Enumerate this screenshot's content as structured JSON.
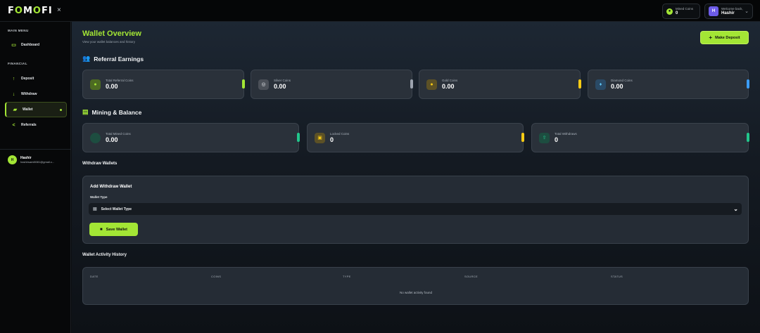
{
  "app": {
    "logo_prefix": "F",
    "logo_o": "O",
    "logo_m": "M",
    "logo_o2": "O",
    "logo_suffix": "FI",
    "close": "×"
  },
  "topbar": {
    "mined_label": "Mined Coins",
    "mined_value": "0",
    "welcome_label": "Welcome back,",
    "user_name": "Hashir",
    "user_initial": "H"
  },
  "sidebar": {
    "main_menu_title": "MAIN MENU",
    "financial_title": "FINANCIAL",
    "items": [
      {
        "label": "Dashboard",
        "icon": "monitor-icon"
      },
      {
        "label": "Deposit",
        "icon": "arrow-up-icon"
      },
      {
        "label": "Withdraw",
        "icon": "arrow-down-icon"
      },
      {
        "label": "Wallet",
        "icon": "wallet-icon"
      },
      {
        "label": "Referrals",
        "icon": "share-icon"
      }
    ],
    "profile_initial": "H",
    "profile_name": "Hashir",
    "profile_email": "hashirsami8081@gmail.c..."
  },
  "page": {
    "title": "Wallet Overview",
    "subtitle": "View your wallet balances and history",
    "deposit_button": "Make Deposit"
  },
  "referral": {
    "heading": "Referral Earnings",
    "cards": [
      {
        "label": "Total Referral Coins",
        "value": "0.00",
        "icon": "users-icon",
        "color": "#a3e635"
      },
      {
        "label": "Silver Coins",
        "value": "0.00",
        "icon": "silver-coin-icon",
        "color": "#9ca3af"
      },
      {
        "label": "Gold Coins",
        "value": "0.00",
        "icon": "gold-coin-icon",
        "color": "#facc15"
      },
      {
        "label": "Diamond Coins",
        "value": "0.00",
        "icon": "diamond-icon",
        "color": "#3b9cf6"
      }
    ]
  },
  "mining": {
    "heading": "Mining & Balance",
    "cards": [
      {
        "label": "Total Mined Coins",
        "value": "0.00",
        "icon": "mined-coin-icon",
        "color": "#22c58b"
      },
      {
        "label": "Locked Coins",
        "value": "0",
        "icon": "lock-icon",
        "color": "#facc15"
      },
      {
        "label": "Total Withdraws",
        "value": "0",
        "icon": "withdraw-icon",
        "color": "#22c58b"
      }
    ]
  },
  "withdraw_wallets": {
    "heading": "Withdraw Wallets",
    "panel_title": "Add Withdraw Wallet",
    "field_label": "Wallet Type",
    "select_value": "Select Wallet Type",
    "save_button": "Save Wallet"
  },
  "activity": {
    "heading": "Wallet Activity History",
    "columns": [
      "DATE",
      "COINS",
      "TYPE",
      "SOURCE",
      "STATUS"
    ],
    "empty_message": "No wallet activity found"
  },
  "colors": {
    "accent": "#a3e635",
    "background": "#0b0d10"
  }
}
